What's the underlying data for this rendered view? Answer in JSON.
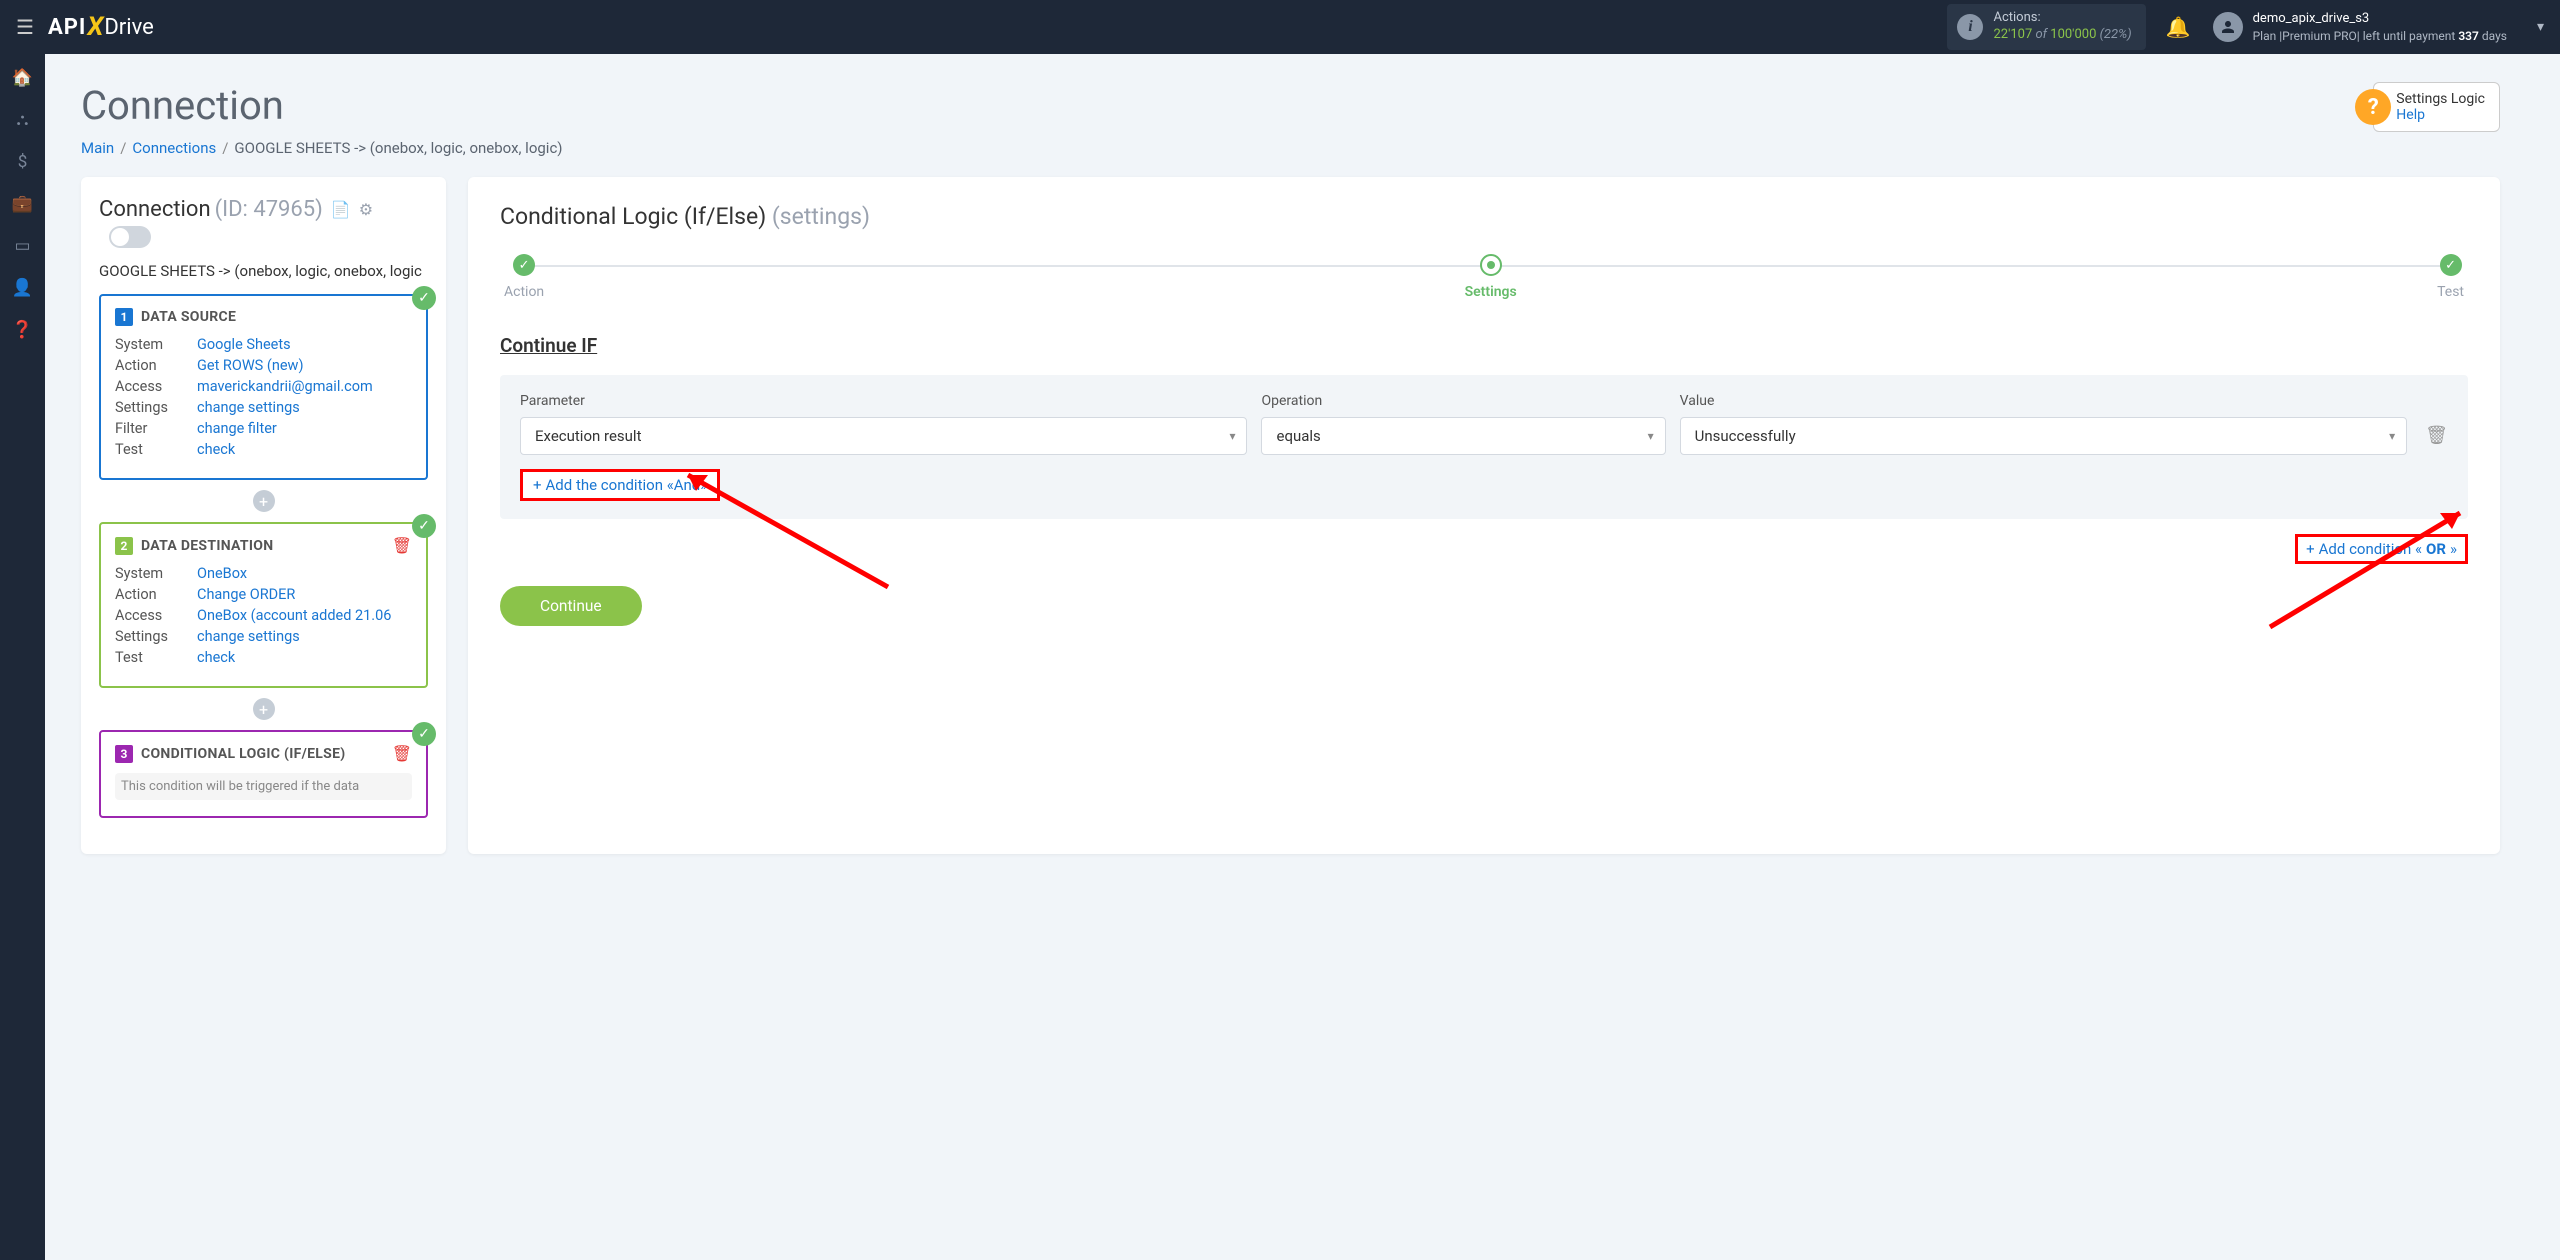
{
  "topbar": {
    "logo_api": "API",
    "logo_drive": "Drive",
    "actions_label": "Actions:",
    "actions_used": "22'107",
    "actions_of": " of ",
    "actions_total": "100'000",
    "actions_pct": " (22%)",
    "user_name": "demo_apix_drive_s3",
    "user_plan_prefix": "Plan |Premium PRO| left until payment ",
    "user_days": "337",
    "user_days_suffix": " days"
  },
  "page": {
    "title": "Connection",
    "bc_main": "Main",
    "bc_connections": "Connections",
    "bc_current": "GOOGLE SHEETS -> (onebox, logic, onebox, logic)"
  },
  "help": {
    "title": "Settings Logic",
    "link": "Help"
  },
  "conn": {
    "heading": "Connection",
    "id": " (ID: 47965)",
    "path": "GOOGLE SHEETS -> (onebox, logic, onebox, logic"
  },
  "ds": {
    "title": "DATA SOURCE",
    "k_system": "System",
    "v_system": "Google Sheets",
    "k_action": "Action",
    "v_action": "Get ROWS (new)",
    "k_access": "Access",
    "v_access": "maverickandrii@gmail.com",
    "k_settings": "Settings",
    "v_settings": "change settings",
    "k_filter": "Filter",
    "v_filter": "change filter",
    "k_test": "Test",
    "v_test": "check"
  },
  "dd": {
    "title": "DATA DESTINATION",
    "k_system": "System",
    "v_system": "OneBox",
    "k_action": "Action",
    "v_action": "Change ORDER",
    "k_access": "Access",
    "v_access": "OneBox (account added 21.06",
    "k_settings": "Settings",
    "v_settings": "change settings",
    "k_test": "Test",
    "v_test": "check"
  },
  "cl": {
    "title": "CONDITIONAL LOGIC (IF/ELSE)",
    "note": "This condition will be triggered if the data"
  },
  "right": {
    "title_main": "Conditional Logic (If/Else) ",
    "title_sub": "(settings)",
    "step_action": "Action",
    "step_settings": "Settings",
    "step_test": "Test",
    "continue_if": "Continue IF",
    "lbl_parameter": "Parameter",
    "lbl_operation": "Operation",
    "lbl_value": "Value",
    "val_parameter": "Execution result",
    "val_operation": "equals",
    "val_value": "Unsuccessfully",
    "add_and": "Add the condition «And»",
    "add_or_prefix": "Add condition «",
    "add_or_bold": "OR",
    "add_or_suffix": "»",
    "continue_btn": "Continue"
  }
}
